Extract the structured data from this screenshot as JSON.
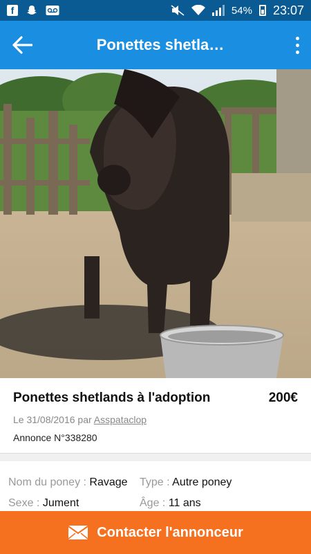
{
  "status_bar": {
    "battery": "54%",
    "time": "23:07"
  },
  "app_bar": {
    "title": "Ponettes shetla…"
  },
  "listing": {
    "title": "Ponettes shetlands à l'adoption",
    "price": "200€",
    "date_prefix": "Le 31/08/2016 par",
    "author": "Asspataclop",
    "ad_number": "Annonce N°338280"
  },
  "details": {
    "name_label": "Nom du poney :",
    "name_value": "Ravage",
    "type_label": "Type :",
    "type_value": "Autre poney",
    "sex_label": "Sexe :",
    "sex_value": "Jument",
    "age_label": "Âge :",
    "age_value": "11 ans"
  },
  "cta": {
    "label": "Contacter l'annonceur",
    "icon": "mail-icon"
  },
  "colors": {
    "status_bar": "#0a5a94",
    "app_bar": "#1a8ee1",
    "cta": "#f5701f"
  }
}
